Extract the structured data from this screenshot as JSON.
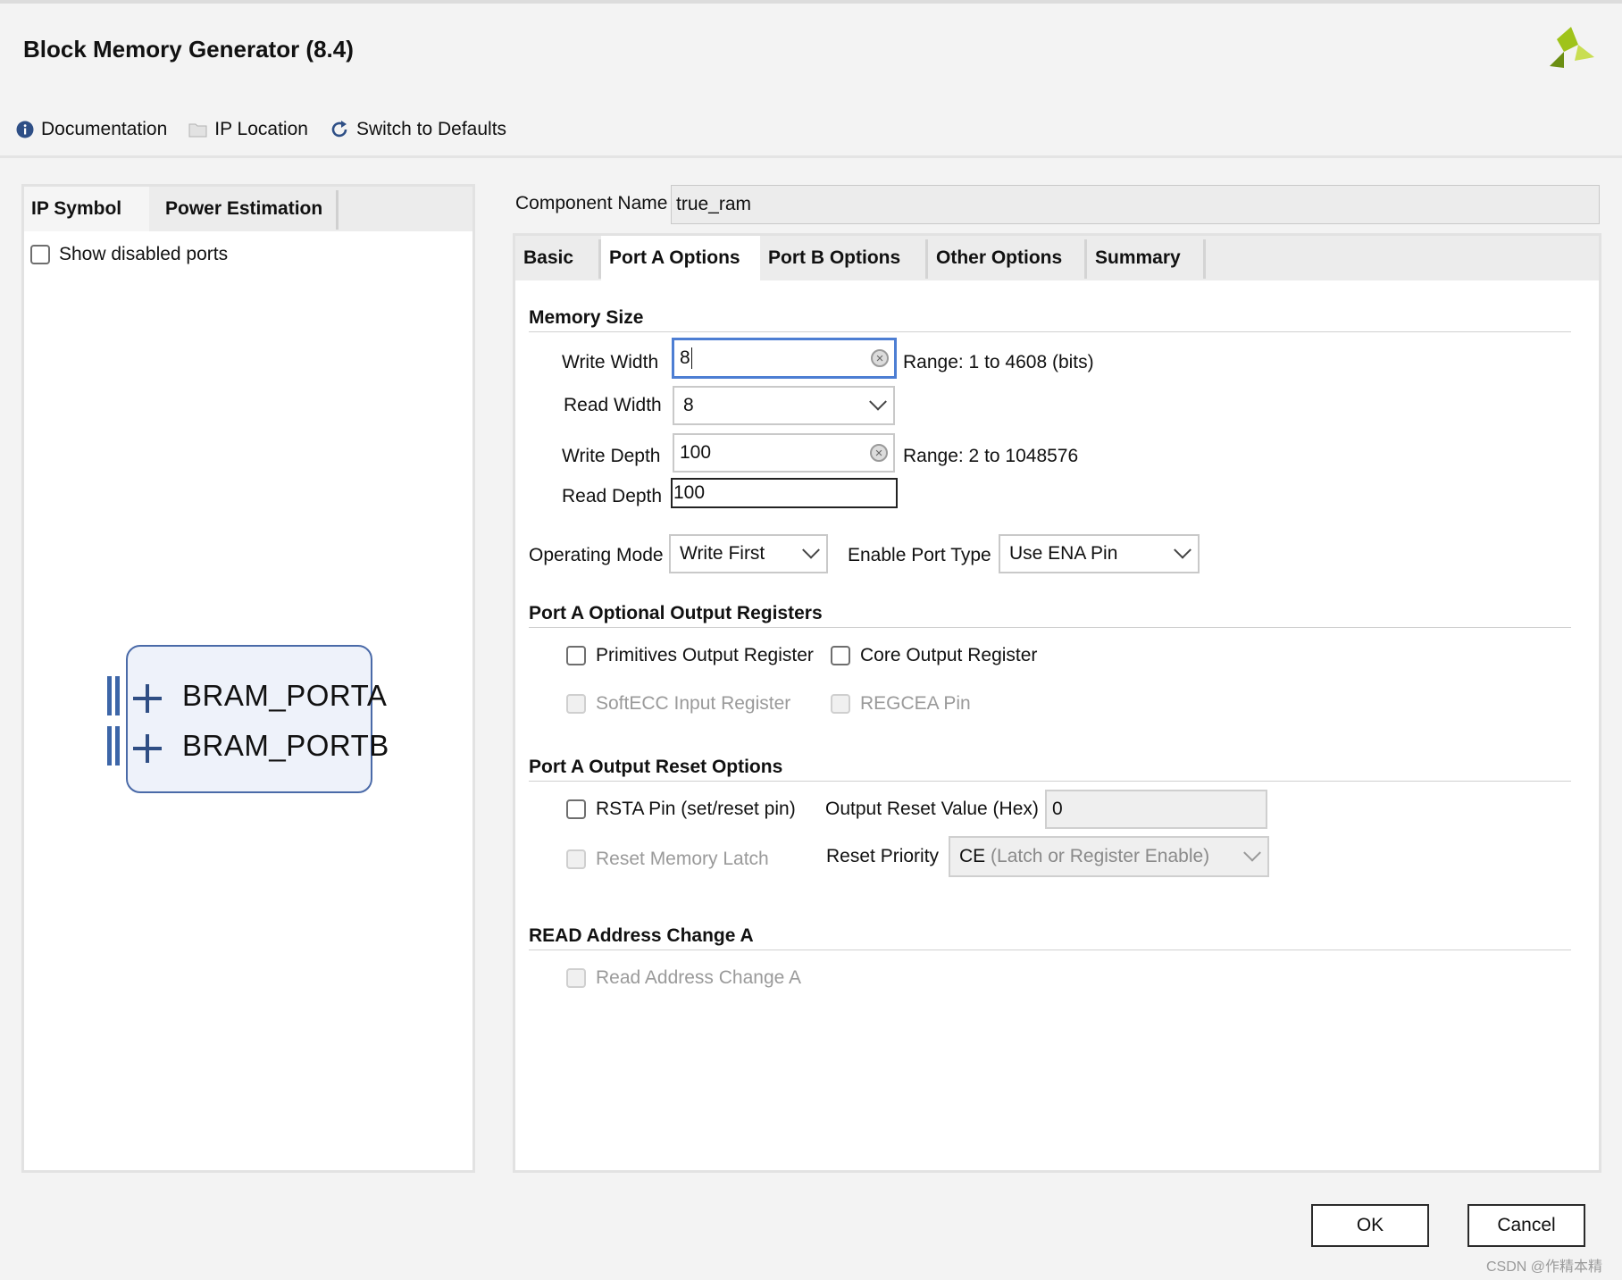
{
  "window": {
    "title": "Block Memory Generator (8.4)"
  },
  "toolbar": {
    "documentation": "Documentation",
    "ip_location": "IP Location",
    "switch_defaults": "Switch to Defaults"
  },
  "left_panel": {
    "tabs": [
      "IP Symbol",
      "Power Estimation"
    ],
    "active_tab": "IP Symbol",
    "show_disabled_label": "Show disabled ports",
    "show_disabled_checked": false,
    "symbol_ports": [
      "BRAM_PORTA",
      "BRAM_PORTB"
    ]
  },
  "component": {
    "label": "Component Name",
    "value": "true_ram"
  },
  "tabs": [
    "Basic",
    "Port A Options",
    "Port B Options",
    "Other Options",
    "Summary"
  ],
  "active_tab": "Port A Options",
  "memory_size": {
    "heading": "Memory Size",
    "write_width_label": "Write Width",
    "write_width": "8",
    "write_width_range": "Range: 1 to 4608 (bits)",
    "read_width_label": "Read Width",
    "read_width": "8",
    "write_depth_label": "Write Depth",
    "write_depth": "100",
    "write_depth_range": "Range: 2 to 1048576",
    "read_depth_label": "Read Depth",
    "read_depth": "100"
  },
  "operating_mode": {
    "label": "Operating Mode",
    "value": "Write First"
  },
  "enable_port_type": {
    "label": "Enable Port Type",
    "value": "Use ENA Pin"
  },
  "output_registers": {
    "heading": "Port A Optional Output Registers",
    "primitives": "Primitives Output Register",
    "core": "Core Output Register",
    "softecc": "SoftECC Input Register",
    "regcea": "REGCEA Pin"
  },
  "reset_options": {
    "heading": "Port A Output Reset Options",
    "rsta": "RSTA Pin (set/reset pin)",
    "output_reset_label": "Output Reset Value (Hex)",
    "output_reset_value": "0",
    "reset_memory_latch": "Reset Memory Latch",
    "reset_priority_label": "Reset Priority",
    "reset_priority_value": "CE",
    "reset_priority_hint": "(Latch or Register Enable)"
  },
  "read_address": {
    "heading": "READ Address Change A",
    "checkbox": "Read Address Change A"
  },
  "buttons": {
    "ok": "OK",
    "cancel": "Cancel"
  },
  "watermark": "CSDN @作精本精",
  "colors": {
    "accent_blue": "#4d7ed3",
    "symbol_border": "#4a6aa8",
    "logo_green": "#9fc31a"
  }
}
